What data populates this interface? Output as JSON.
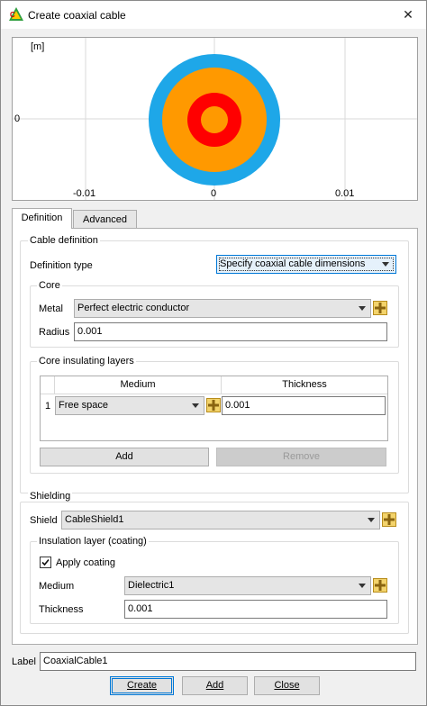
{
  "window": {
    "title": "Create coaxial cable",
    "close_glyph": "✕"
  },
  "preview": {
    "unit_label": "[m]",
    "y_tick": "0",
    "x_ticks": [
      "-0.01",
      "0",
      "0.01"
    ],
    "colors": {
      "shield": "#1ea7e8",
      "insulation": "#ff9900",
      "core": "#ff0000",
      "center": "#ff9900"
    }
  },
  "tabs": [
    {
      "label": "Definition"
    },
    {
      "label": "Advanced"
    }
  ],
  "cable_definition": {
    "title": "Cable definition",
    "definition_type_label": "Definition type",
    "definition_type_value": "Specify coaxial cable dimensions"
  },
  "core": {
    "title": "Core",
    "metal_label": "Metal",
    "metal_value": "Perfect electric conductor",
    "radius_label": "Radius",
    "radius_value": "0.001"
  },
  "core_layers": {
    "title": "Core insulating layers",
    "columns": [
      "Medium",
      "Thickness"
    ],
    "rows": [
      {
        "index": "1",
        "medium": "Free space",
        "thickness": "0.001"
      }
    ],
    "add_label": "Add",
    "remove_label": "Remove"
  },
  "shielding": {
    "title": "Shielding",
    "shield_label": "Shield",
    "shield_value": "CableShield1"
  },
  "insulation": {
    "title": "Insulation layer (coating)",
    "apply_label": "Apply coating",
    "apply_checked": true,
    "medium_label": "Medium",
    "medium_value": "Dielectric1",
    "thickness_label": "Thickness",
    "thickness_value": "0.001"
  },
  "footer": {
    "label_label": "Label",
    "label_value": "CoaxialCable1",
    "create_label": "Create",
    "add_label": "Add",
    "close_label": "Close"
  }
}
